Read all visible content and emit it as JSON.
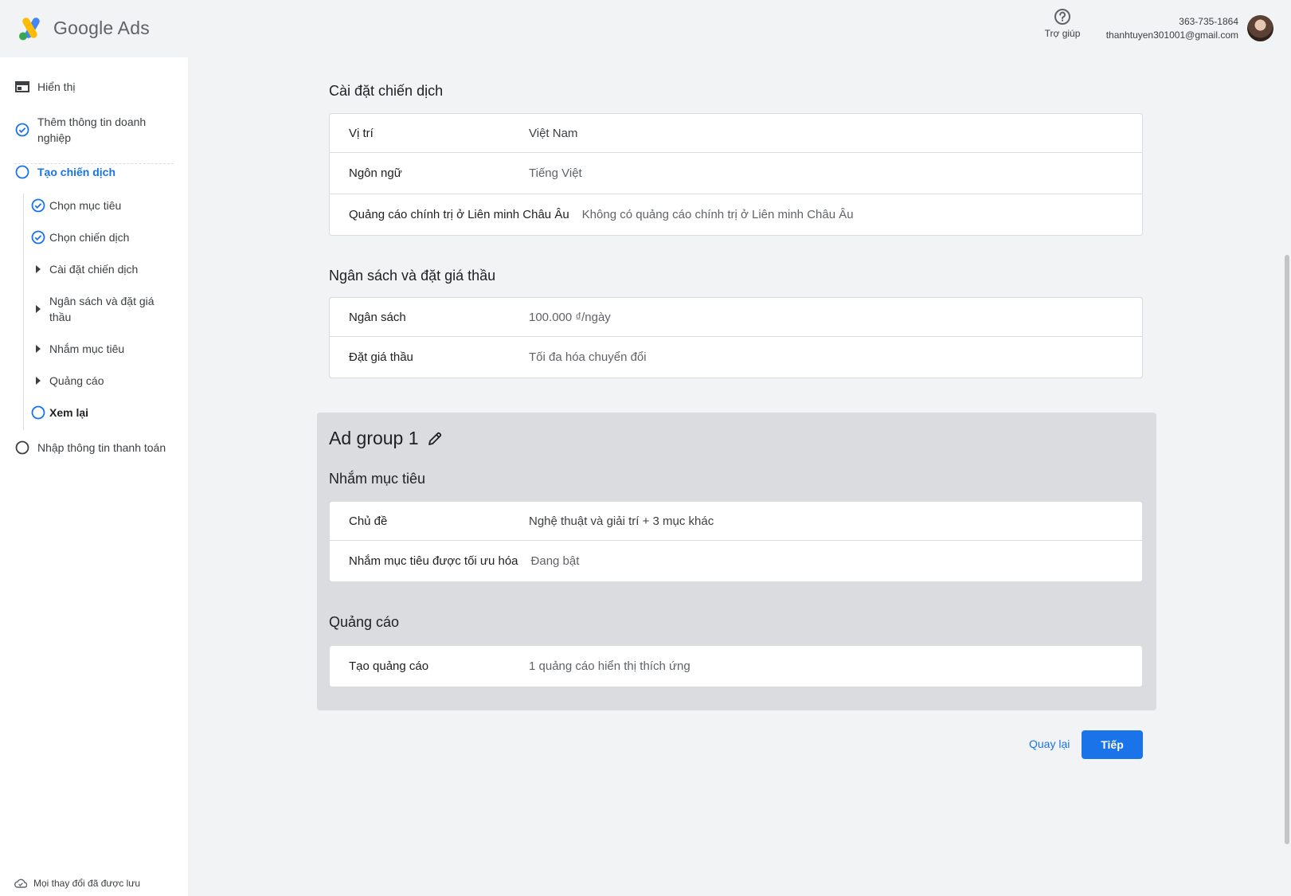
{
  "header": {
    "brand": "Google Ads",
    "help_label": "Trợ giúp",
    "phone": "363-735-1864",
    "email": "thanhtuyen301001@gmail.com"
  },
  "sidebar": {
    "items": [
      {
        "label": "Hiển thị",
        "icon": "display-icon"
      },
      {
        "label": "Thêm thông tin doanh nghiệp",
        "icon": "check-circle-icon"
      },
      {
        "label": "Tạo chiến dịch",
        "icon": "empty-circle-icon"
      },
      {
        "label": "Chọn mục tiêu",
        "icon": "check-circle-icon"
      },
      {
        "label": "Chọn chiến dịch",
        "icon": "check-circle-icon"
      },
      {
        "label": "Cài đặt chiến dịch",
        "icon": "caret-right-icon"
      },
      {
        "label": "Ngân sách và đặt giá thầu",
        "icon": "caret-right-icon"
      },
      {
        "label": "Nhắm mục tiêu",
        "icon": "caret-right-icon"
      },
      {
        "label": "Quảng cáo",
        "icon": "caret-right-icon"
      },
      {
        "label": "Xem lại",
        "icon": "empty-circle-icon"
      },
      {
        "label": "Nhập thông tin thanh toán",
        "icon": "empty-circle-icon"
      }
    ],
    "saved_status": "Mọi thay đổi đã được lưu"
  },
  "campaign_settings": {
    "title": "Cài đặt chiến dịch",
    "rows": [
      {
        "key": "Vị trí",
        "value": "Việt Nam"
      },
      {
        "key": "Ngôn ngữ",
        "value": "Tiếng Việt"
      },
      {
        "key": "Quảng cáo chính trị ở Liên minh Châu Âu",
        "value": "Không có quảng cáo chính trị ở Liên minh Châu Âu"
      }
    ]
  },
  "budget": {
    "title": "Ngân sách và đặt giá thầu",
    "rows": [
      {
        "key": "Ngân sách",
        "value": "100.000 ₫/ngày"
      },
      {
        "key": "Đặt giá thầu",
        "value": "Tối đa hóa chuyển đổi"
      }
    ]
  },
  "ad_group": {
    "title": "Ad group 1",
    "targeting": {
      "title": "Nhắm mục tiêu",
      "rows": [
        {
          "key": "Chủ đề",
          "value": "Nghệ thuật và giải trí + 3 mục khác"
        },
        {
          "key": "Nhắm mục tiêu được tối ưu hóa",
          "value": "Đang bật"
        }
      ]
    },
    "ads": {
      "title": "Quảng cáo",
      "rows": [
        {
          "key": "Tạo quảng cáo",
          "value": "1 quảng cáo hiển thị thích ứng"
        }
      ]
    }
  },
  "actions": {
    "back": "Quay lại",
    "next": "Tiếp"
  },
  "colors": {
    "accent": "#1a73e8",
    "background": "#f1f3f4",
    "ad_group_bg": "#dadce0"
  }
}
